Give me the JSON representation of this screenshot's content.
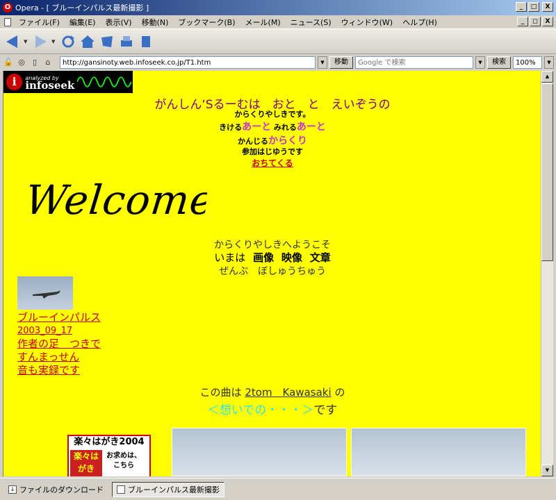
{
  "window": {
    "title": "Opera - [ ブルーインパルス最新撮影 ]",
    "buttons": {
      "minimize": "_",
      "maximize": "□",
      "close": "X",
      "doc_minimize": "_",
      "doc_restore": "◻",
      "doc_close": "X"
    }
  },
  "menu": {
    "items": [
      {
        "label": "ファイル(F)"
      },
      {
        "label": "編集(E)"
      },
      {
        "label": "表示(V)"
      },
      {
        "label": "移動(N)"
      },
      {
        "label": "ブックマーク(B)"
      },
      {
        "label": "メール(M)"
      },
      {
        "label": "ニュース(S)"
      },
      {
        "label": "ウィンドウ(W)"
      },
      {
        "label": "ヘルプ(H)"
      }
    ]
  },
  "address": {
    "url": "http://gansinoty.web.infoseek.co.jp/T1.htm",
    "go_label": "移動",
    "search_placeholder": "Google で検索",
    "search_label": "検索",
    "zoom": "100%"
  },
  "page": {
    "badge": {
      "small": "analyzed by",
      "big": "infoseek"
    },
    "heading": "がんしん‘Sるーむは　おと　と　えいぞうの",
    "line1": "からくりやしきです。",
    "line2_a": "きける",
    "line2_b": "あーと",
    "line2_c": "  みれる",
    "line2_d": "あーと",
    "line3_a": "かんじる",
    "line3_b": "からくり",
    "line4": "参加はじゆうです",
    "line5_link": "おちてくる",
    "welcome": "Welcome!",
    "intro1": "からくりやしきへようこそ",
    "intro2_a": "いまは",
    "intro2_b": "画像",
    "intro2_c": "映像",
    "intro2_d": "文章",
    "intro3": "ぜんぶ　ぼしゅうちゅう",
    "links": [
      {
        "label": "ブルーインパルス"
      },
      {
        "label": "2003_09_17"
      },
      {
        "label": "作者の足　つきで"
      },
      {
        "label": "すんまっせん"
      },
      {
        "label": "音も実録です"
      }
    ],
    "song_a": "この曲は",
    "song_link": "2tom　Kawasaki",
    "song_b": "の",
    "song_title": "＜想いでの・・・＞",
    "song_c": "です",
    "banner": {
      "top": "楽々はがき2004",
      "red": "楽々はがき",
      "cta_a": "お求めは、",
      "cta_b": "こちら"
    }
  },
  "taskbar": {
    "items": [
      {
        "label": "ファイルのダウンロード"
      },
      {
        "label": "ブルーインパルス最新撮影"
      }
    ]
  }
}
